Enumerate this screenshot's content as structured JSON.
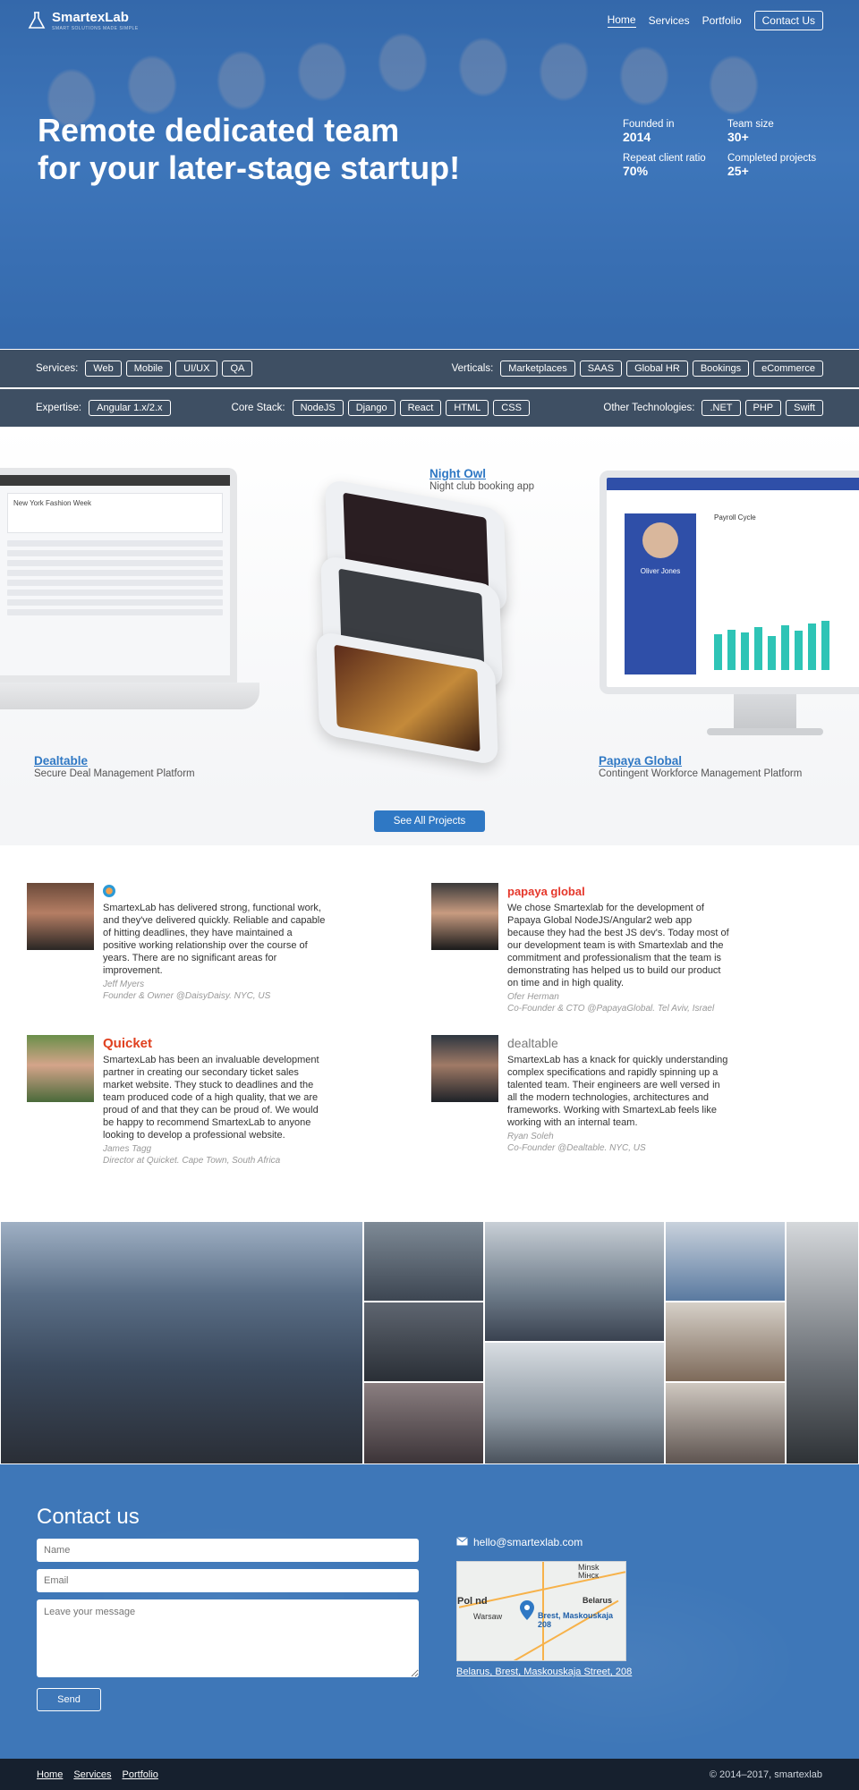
{
  "brand": {
    "name": "SmartexLab",
    "tagline": "SMART SOLUTIONS MADE SIMPLE"
  },
  "nav": {
    "items": [
      "Home",
      "Services",
      "Portfolio"
    ],
    "contact": "Contact Us"
  },
  "hero": {
    "title_line1": "Remote dedicated team",
    "title_line2": "for your later-stage startup!",
    "stats": [
      {
        "label": "Founded in",
        "value": "2014"
      },
      {
        "label": "Team size",
        "value": "30+"
      },
      {
        "label": "Repeat client ratio",
        "value": "70%"
      },
      {
        "label": "Completed projects",
        "value": "25+"
      }
    ]
  },
  "tags": {
    "services": {
      "label": "Services:",
      "items": [
        "Web",
        "Mobile",
        "UI/UX",
        "QA"
      ]
    },
    "verticals": {
      "label": "Verticals:",
      "items": [
        "Marketplaces",
        "SAAS",
        "Global HR",
        "Bookings",
        "eCommerce"
      ]
    },
    "expertise": {
      "label": "Expertise:",
      "items": [
        "Angular 1.x/2.x"
      ]
    },
    "core_stack": {
      "label": "Core Stack:",
      "items": [
        "NodeJS",
        "Django",
        "React",
        "HTML",
        "CSS"
      ]
    },
    "other": {
      "label": "Other Technologies:",
      "items": [
        ".NET",
        "PHP",
        "Swift"
      ]
    }
  },
  "projects": [
    {
      "name": "Night Owl",
      "desc": "Night club booking app"
    },
    {
      "name": "Dealtable",
      "desc": "Secure Deal Management Platform"
    },
    {
      "name": "Papaya Global",
      "desc": "Contingent Workforce Management Platform"
    }
  ],
  "mockups": {
    "dealtable_card": "New York Fashion Week",
    "papaya_payroll": "Payroll Cycle",
    "papaya_person": "Oliver Jones"
  },
  "see_all": "See All Projects",
  "testimonials": [
    {
      "logo": "",
      "quote": "SmartexLab has delivered strong, functional work, and they've delivered quickly. Reliable and capable of hitting deadlines, they have maintained a positive working relationship over the course of years. There are no significant areas for improvement.",
      "name": "Jeff Myers",
      "role": "Founder & Owner @DaisyDaisy. NYC, US"
    },
    {
      "logo": "papaya global",
      "quote": "We chose Smartexlab for the development of Papaya Global NodeJS/Angular2 web app because they had the best JS dev's. Today most of our development team is with Smartexlab and the commitment and professionalism that the team is demonstrating has helped us to build our product on time and in high quality.",
      "name": "Ofer Herman",
      "role": "Co-Founder & CTO @PapayaGlobal. Tel Aviv, Israel"
    },
    {
      "logo": "Quicket",
      "quote": "SmartexLab has been an invaluable development partner in creating our secondary ticket sales market website. They stuck to deadlines and the team produced code of a high quality, that we are proud of and that they can be proud of. We would be happy to recommend SmartexLab to anyone looking to develop a professional website.",
      "name": "James Tagg",
      "role": "Director at Quicket. Cape Town, South Africa"
    },
    {
      "logo": "dealtable",
      "quote": "SmartexLab has a knack for quickly understanding complex specifications and rapidly spinning up a talented team. Their engineers are well versed in all the modern technologies, architectures and frameworks. Working with SmartexLab feels like working with an internal team.",
      "name": "Ryan Soleh",
      "role": "Co-Founder @Dealtable. NYC, US"
    }
  ],
  "contact": {
    "title": "Contact us",
    "name_placeholder": "Name",
    "email_placeholder": "Email",
    "message_placeholder": "Leave your message",
    "send": "Send",
    "email": "hello@smartexlab.com",
    "address": "Belarus, Brest, Maskouskaja Street, 208",
    "map_labels": {
      "minsk": "Minsk\nМінск",
      "belarus": "Belarus",
      "warsaw": "Warsaw",
      "poland": "Pol nd",
      "pin": "Brest, Maskouskaja 208"
    }
  },
  "footer": {
    "links": [
      "Home",
      "Services",
      "Portfolio"
    ],
    "copyright": "© 2014–2017, smartexlab"
  },
  "colors": {
    "accent": "#2f78c4",
    "contact_bg": "#3e77b8",
    "footer_bg": "#16202e",
    "tagbar_bg": "#142841"
  }
}
